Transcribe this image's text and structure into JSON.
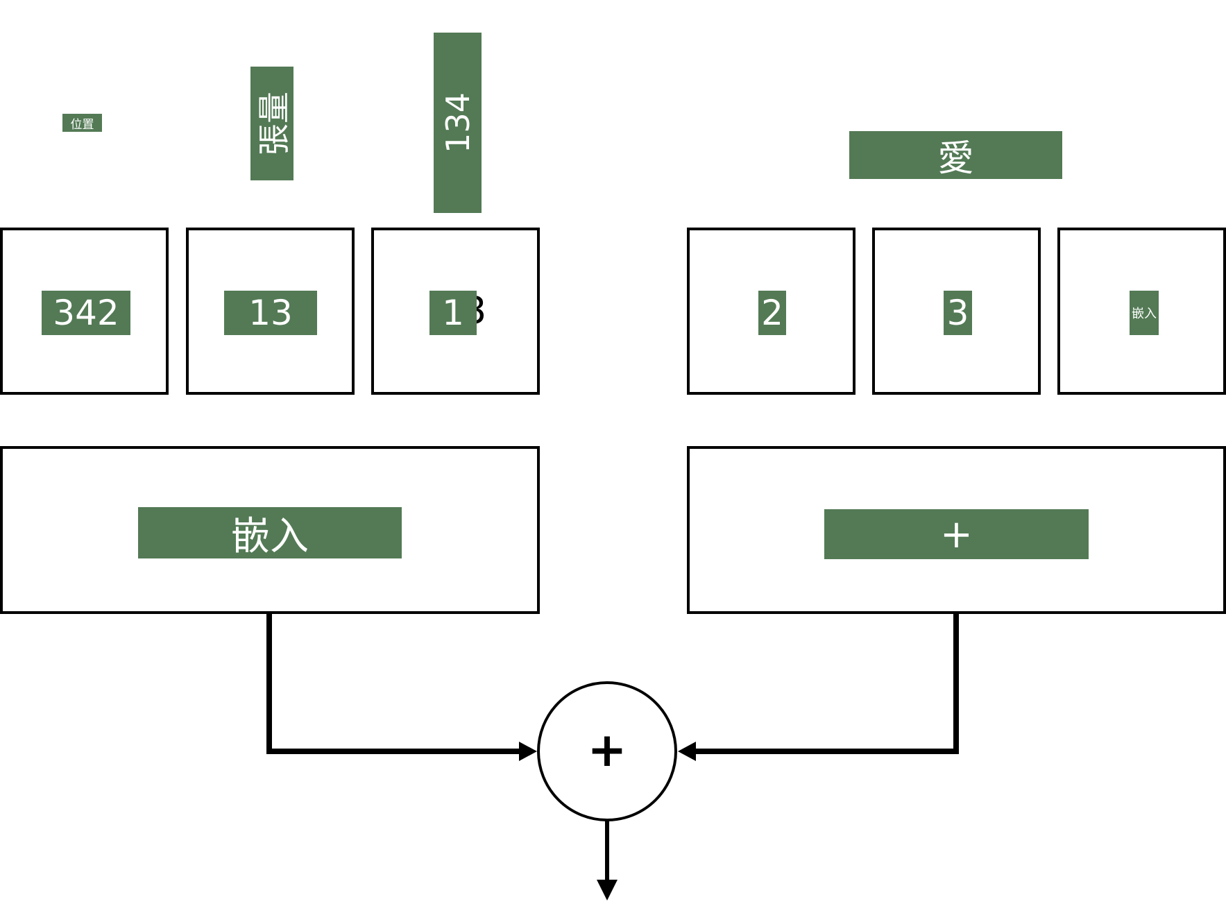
{
  "colors": {
    "label_bg": "#537a55",
    "label_text": "#ffffff",
    "stroke": "#000000"
  },
  "top_labels": {
    "position": "位置",
    "tensor": "張量",
    "number": "134",
    "love": "愛"
  },
  "left_tokens": [
    "342",
    "13",
    "1"
  ],
  "left_token_overflow_glyph": "3",
  "right_tokens": [
    "2",
    "3",
    "嵌入"
  ],
  "left_block_label": "嵌入",
  "right_block_label": "+",
  "sum_symbol": "+"
}
